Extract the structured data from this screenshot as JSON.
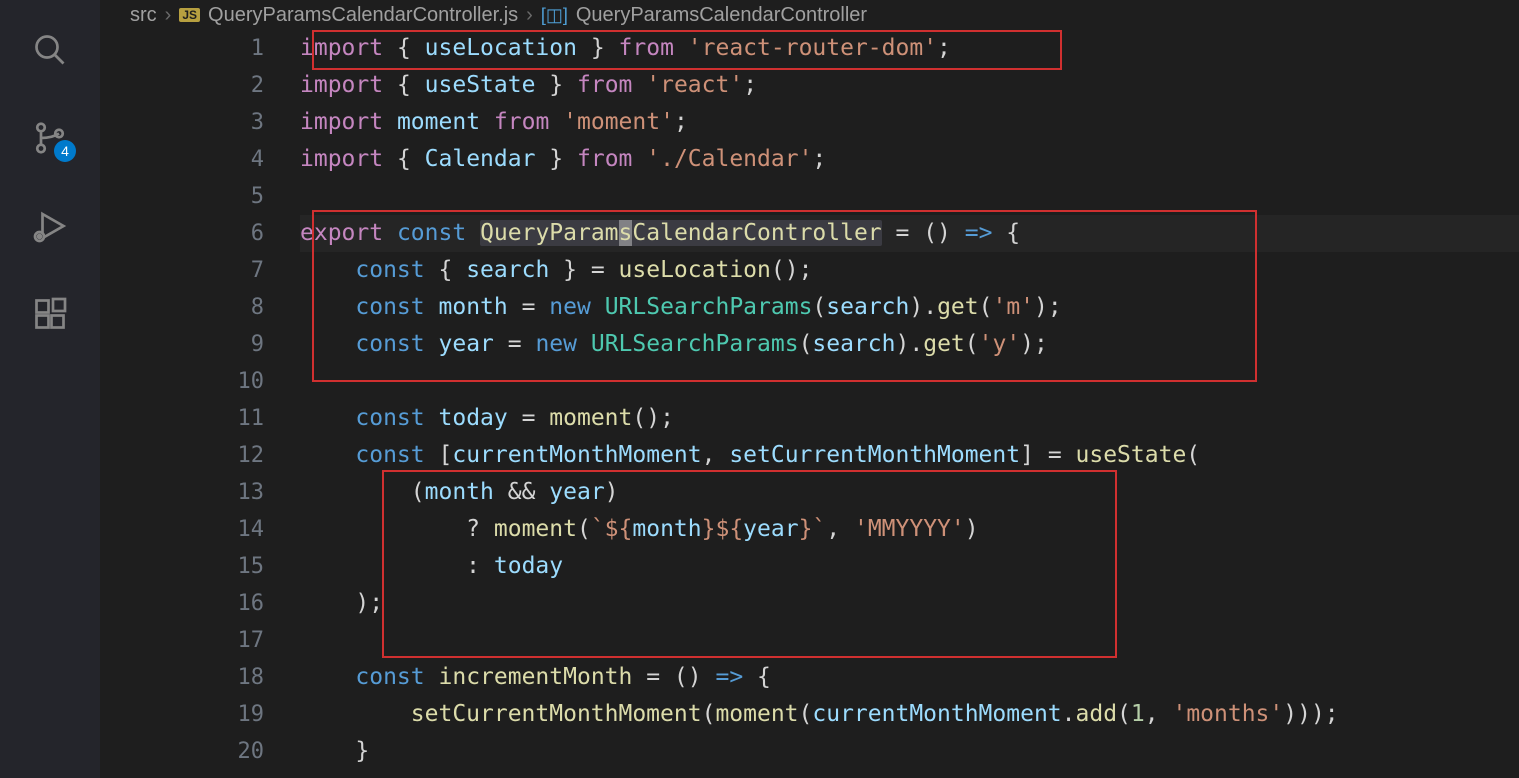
{
  "activityBar": {
    "scmBadge": "4"
  },
  "breadcrumb": {
    "folder": "src",
    "jsLabel": "JS",
    "file": "QueryParamsCalendarController.js",
    "symbol": "QueryParamsCalendarController"
  },
  "lineNumbers": [
    "1",
    "2",
    "3",
    "4",
    "5",
    "6",
    "7",
    "8",
    "9",
    "10",
    "11",
    "12",
    "13",
    "14",
    "15",
    "16",
    "17",
    "18",
    "19",
    "20"
  ],
  "code": {
    "l1": {
      "import": "import",
      "lb": "{ ",
      "useLocation": "useLocation",
      "rb": " }",
      "from": "from",
      "str": "'react-router-dom'",
      "semi": ";"
    },
    "l2": {
      "import": "import",
      "lb": "{ ",
      "useState": "useState",
      "rb": " }",
      "from": "from",
      "str": "'react'",
      "semi": ";"
    },
    "l3": {
      "import": "import",
      "moment": "moment",
      "from": "from",
      "str": "'moment'",
      "semi": ";"
    },
    "l4": {
      "import": "import",
      "lb": "{ ",
      "Calendar": "Calendar",
      "rb": " }",
      "from": "from",
      "str": "'./Calendar'",
      "semi": ";"
    },
    "l6": {
      "export": "export",
      "const": "const",
      "name1": "QueryParam",
      "cursor": "s",
      "name2": "CalendarController",
      "eq": " = () ",
      "arrow": "=>",
      "brace": " {"
    },
    "l7": {
      "const": "const",
      "lb": "{ ",
      "search": "search",
      "rb": " }",
      "eq": " = ",
      "useLocation": "useLocation",
      "call": "();"
    },
    "l8": {
      "const": "const",
      "month": "month",
      "eq": " = ",
      "new": "new",
      "URLSearchParams": "URLSearchParams",
      "lp": "(",
      "search": "search",
      "rp": ").",
      "get": "get",
      "lp2": "(",
      "str": "'m'",
      "rp2": ");"
    },
    "l9": {
      "const": "const",
      "year": "year",
      "eq": " = ",
      "new": "new",
      "URLSearchParams": "URLSearchParams",
      "lp": "(",
      "search": "search",
      "rp": ").",
      "get": "get",
      "lp2": "(",
      "str": "'y'",
      "rp2": ");"
    },
    "l11": {
      "const": "const",
      "today": "today",
      "eq": " = ",
      "moment": "moment",
      "call": "();"
    },
    "l12": {
      "const": "const",
      "lb": "[",
      "currentMonthMoment": "currentMonthMoment",
      "comma": ", ",
      "setter": "setCurrentMonthMoment",
      "rb": "]",
      "eq": " = ",
      "useState": "useState",
      "lp": "("
    },
    "l13": {
      "lp": "(",
      "month": "month",
      "and": " && ",
      "year": "year",
      "rp": ")"
    },
    "l14": {
      "q": "? ",
      "moment": "moment",
      "lp": "(",
      "bt1": "`${",
      "month": "month",
      "mid": "}${",
      "year": "year",
      "bt2": "}`",
      "comma": ", ",
      "str": "'MMYYYY'",
      "rp": ")"
    },
    "l15": {
      "colon": ": ",
      "today": "today"
    },
    "l16": {
      "rp": ");"
    },
    "l18": {
      "const": "const",
      "incrementMonth": "incrementMonth",
      "eq": " = () ",
      "arrow": "=>",
      "brace": " {"
    },
    "l19": {
      "setter": "setCurrentMonthMoment",
      "lp": "(",
      "moment": "moment",
      "lp2": "(",
      "cmm": "currentMonthMoment",
      "dot": ".",
      "add": "add",
      "lp3": "(",
      "one": "1",
      "comma": ", ",
      "str": "'months'",
      "rp": ")));"
    },
    "l20": {
      "brace": "}"
    }
  }
}
